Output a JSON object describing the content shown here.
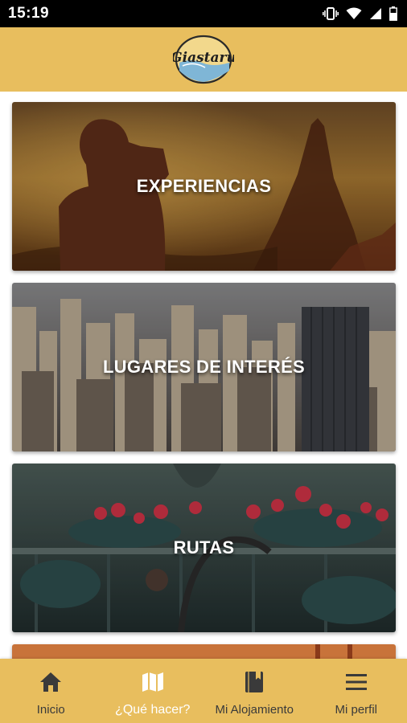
{
  "status_bar": {
    "time": "15:19",
    "icons": [
      "vibrate-icon",
      "wifi-icon",
      "signal-icon",
      "battery-icon"
    ]
  },
  "header": {
    "logo_text": "Giastaru"
  },
  "cards": [
    {
      "label": "EXPERIENCIAS"
    },
    {
      "label": "LUGARES DE INTERÉS"
    },
    {
      "label": "RUTAS"
    }
  ],
  "bottom_nav": {
    "active_index": 1,
    "items": [
      {
        "label": "Inicio",
        "icon": "home-icon"
      },
      {
        "label": "¿Qué hacer?",
        "icon": "map-icon"
      },
      {
        "label": "Mi Alojamiento",
        "icon": "book-icon"
      },
      {
        "label": "Mi perfil",
        "icon": "menu-icon"
      }
    ]
  },
  "colors": {
    "accent": "#e8be5e",
    "active_nav_text": "#ffffff",
    "nav_text": "#3a3a3a",
    "status_bar": "#000000"
  }
}
